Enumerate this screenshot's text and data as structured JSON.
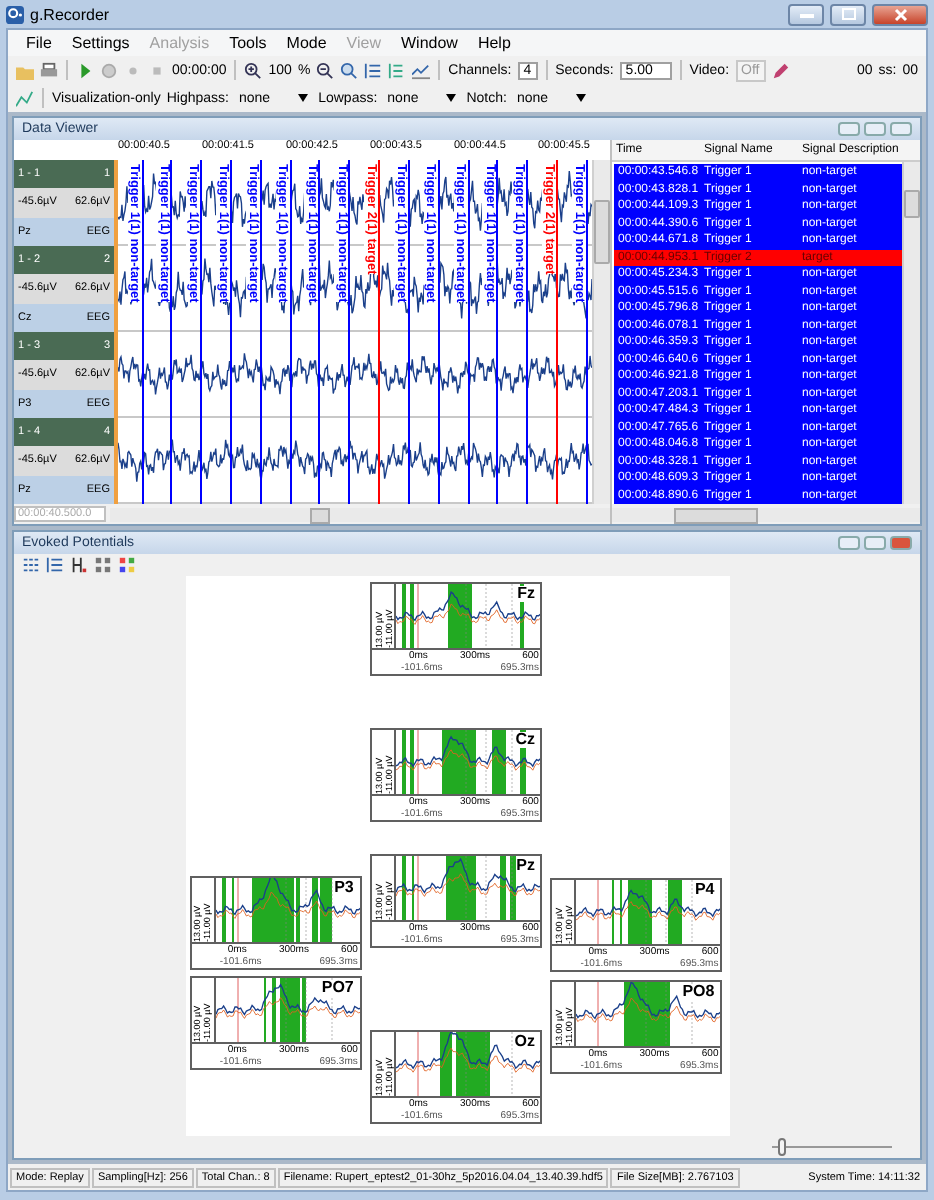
{
  "window": {
    "title": "g.Recorder"
  },
  "menu": [
    {
      "label": "File",
      "disabled": false
    },
    {
      "label": "Settings",
      "disabled": false
    },
    {
      "label": "Analysis",
      "disabled": true
    },
    {
      "label": "Tools",
      "disabled": false
    },
    {
      "label": "Mode",
      "disabled": false
    },
    {
      "label": "View",
      "disabled": true
    },
    {
      "label": "Window",
      "disabled": false
    },
    {
      "label": "Help",
      "disabled": false
    }
  ],
  "toolbar": {
    "time": "00:00:00",
    "zoom": "100",
    "zoom_unit": "%",
    "channels_label": "Channels:",
    "channels": "4",
    "seconds_label": "Seconds:",
    "seconds": "5.00",
    "video_label": "Video:",
    "video": "Off",
    "video_disabled": true,
    "clock": [
      "00",
      "ss:",
      "00"
    ]
  },
  "filter_bar": {
    "mode": "Visualization-only",
    "filters": [
      {
        "label": "Highpass:",
        "value": "none"
      },
      {
        "label": "Lowpass:",
        "value": "none"
      },
      {
        "label": "Notch:",
        "value": "none"
      }
    ]
  },
  "data_viewer": {
    "title": "Data Viewer",
    "time_labels": [
      "00:00:40.5",
      "00:00:41.5",
      "00:00:42.5",
      "00:00:43.5",
      "00:00:44.5",
      "00:00:45.5"
    ],
    "channels": [
      {
        "name": "1 - 1",
        "number": "1",
        "min": "-45.6µV",
        "max": "62.6µV",
        "electrode": "Pz",
        "type": "EEG"
      },
      {
        "name": "1 - 2",
        "number": "2",
        "min": "-45.6µV",
        "max": "62.6µV",
        "electrode": "Cz",
        "type": "EEG"
      },
      {
        "name": "1 - 3",
        "number": "3",
        "min": "-45.6µV",
        "max": "62.6µV",
        "electrode": "P3",
        "type": "EEG"
      },
      {
        "name": "1 - 4",
        "number": "4",
        "min": "-45.6µV",
        "max": "62.6µV",
        "electrode": "Pz",
        "type": "EEG"
      }
    ],
    "markers": [
      {
        "label": "Trigger 1(1) non-target",
        "kind": "non-target"
      },
      {
        "label": "Trigger 1(1) non-target",
        "kind": "non-target"
      },
      {
        "label": "Trigger 1(1) non-target",
        "kind": "non-target"
      },
      {
        "label": "Trigger 1(1) non-target",
        "kind": "non-target"
      },
      {
        "label": "Trigger 1(1) non-target",
        "kind": "non-target"
      },
      {
        "label": "Trigger 1(1) non-target",
        "kind": "non-target"
      },
      {
        "label": "Trigger 1(1) non-target",
        "kind": "non-target"
      },
      {
        "label": "Trigger 1(1) non-target",
        "kind": "non-target"
      },
      {
        "label": "Trigger 2(1) target",
        "kind": "target"
      },
      {
        "label": "Trigger 1(1) non-target",
        "kind": "non-target"
      },
      {
        "label": "Trigger 1(1) non-target",
        "kind": "non-target"
      },
      {
        "label": "Trigger 1(1) non-target",
        "kind": "non-target"
      },
      {
        "label": "Trigger 1(1) non-target",
        "kind": "non-target"
      },
      {
        "label": "Trigger 1(1) non-target",
        "kind": "non-target"
      },
      {
        "label": "Trigger 2(1) target",
        "kind": "target"
      },
      {
        "label": "Trigger 1(1) non-target",
        "kind": "non-target"
      }
    ],
    "position": "00:00:40.500.0"
  },
  "events": {
    "columns": [
      "Time",
      "Signal Name",
      "Signal Description"
    ],
    "rows": [
      {
        "time": "00:00:43.546.8",
        "name": "Trigger 1",
        "description": "non-target",
        "color": "#0000ff"
      },
      {
        "time": "00:00:43.828.1",
        "name": "Trigger 1",
        "description": "non-target",
        "color": "#0000ff"
      },
      {
        "time": "00:00:44.109.3",
        "name": "Trigger 1",
        "description": "non-target",
        "color": "#0000ff"
      },
      {
        "time": "00:00:44.390.6",
        "name": "Trigger 1",
        "description": "non-target",
        "color": "#0000ff"
      },
      {
        "time": "00:00:44.671.8",
        "name": "Trigger 1",
        "description": "non-target",
        "color": "#0000ff"
      },
      {
        "time": "00:00:44.953.1",
        "name": "Trigger 2",
        "description": "target",
        "color": "#ff0000"
      },
      {
        "time": "00:00:45.234.3",
        "name": "Trigger 1",
        "description": "non-target",
        "color": "#0000ff"
      },
      {
        "time": "00:00:45.515.6",
        "name": "Trigger 1",
        "description": "non-target",
        "color": "#0000ff"
      },
      {
        "time": "00:00:45.796.8",
        "name": "Trigger 1",
        "description": "non-target",
        "color": "#0000ff"
      },
      {
        "time": "00:00:46.078.1",
        "name": "Trigger 1",
        "description": "non-target",
        "color": "#0000ff"
      },
      {
        "time": "00:00:46.359.3",
        "name": "Trigger 1",
        "description": "non-target",
        "color": "#0000ff"
      },
      {
        "time": "00:00:46.640.6",
        "name": "Trigger 1",
        "description": "non-target",
        "color": "#0000ff"
      },
      {
        "time": "00:00:46.921.8",
        "name": "Trigger 1",
        "description": "non-target",
        "color": "#0000ff"
      },
      {
        "time": "00:00:47.203.1",
        "name": "Trigger 1",
        "description": "non-target",
        "color": "#0000ff"
      },
      {
        "time": "00:00:47.484.3",
        "name": "Trigger 1",
        "description": "non-target",
        "color": "#0000ff"
      },
      {
        "time": "00:00:47.765.6",
        "name": "Trigger 1",
        "description": "non-target",
        "color": "#0000ff"
      },
      {
        "time": "00:00:48.046.8",
        "name": "Trigger 1",
        "description": "non-target",
        "color": "#0000ff"
      },
      {
        "time": "00:00:48.328.1",
        "name": "Trigger 1",
        "description": "non-target",
        "color": "#0000ff"
      },
      {
        "time": "00:00:48.609.3",
        "name": "Trigger 1",
        "description": "non-target",
        "color": "#0000ff"
      },
      {
        "time": "00:00:48.890.6",
        "name": "Trigger 1",
        "description": "non-target",
        "color": "#0000ff"
      }
    ]
  },
  "evoked": {
    "title": "Evoked Potentials",
    "plots": [
      {
        "electrode": "Fz",
        "y_max": "13.00 µV",
        "y_min": "-11.00 µV",
        "x_ticks": [
          "0ms",
          "300ms",
          "600"
        ],
        "x_start": "-101.6ms",
        "x_end": "695.3ms"
      },
      {
        "electrode": "Cz",
        "y_max": "13.00 µV",
        "y_min": "-11.00 µV",
        "x_ticks": [
          "0ms",
          "300ms",
          "600"
        ],
        "x_start": "-101.6ms",
        "x_end": "695.3ms"
      },
      {
        "electrode": "Pz",
        "y_max": "13.00 µV",
        "y_min": "-11.00 µV",
        "x_ticks": [
          "0ms",
          "300ms",
          "600"
        ],
        "x_start": "-101.6ms",
        "x_end": "695.3ms"
      },
      {
        "electrode": "P3",
        "y_max": "13.00 µV",
        "y_min": "-11.00 µV",
        "x_ticks": [
          "0ms",
          "300ms",
          "600"
        ],
        "x_start": "-101.6ms",
        "x_end": "695.3ms"
      },
      {
        "electrode": "P4",
        "y_max": "13.00 µV",
        "y_min": "-11.00 µV",
        "x_ticks": [
          "0ms",
          "300ms",
          "600"
        ],
        "x_start": "-101.6ms",
        "x_end": "695.3ms"
      },
      {
        "electrode": "PO7",
        "y_max": "13.00 µV",
        "y_min": "-11.00 µV",
        "x_ticks": [
          "0ms",
          "300ms",
          "600"
        ],
        "x_start": "-101.6ms",
        "x_end": "695.3ms"
      },
      {
        "electrode": "PO8",
        "y_max": "13.00 µV",
        "y_min": "-11.00 µV",
        "x_ticks": [
          "0ms",
          "300ms",
          "600"
        ],
        "x_start": "-101.6ms",
        "x_end": "695.3ms"
      },
      {
        "electrode": "Oz",
        "y_max": "13.00 µV",
        "y_min": "-11.00 µV",
        "x_ticks": [
          "0ms",
          "300ms",
          "600"
        ],
        "x_start": "-101.6ms",
        "x_end": "695.3ms"
      }
    ],
    "zoom_slider": {
      "level": 0.05
    }
  },
  "status_bar": [
    "Mode: Replay",
    "Sampling[Hz]: 256",
    "Total Chan.: 8",
    "Filename: Rupert_eptest2_01-30hz_5p2016.04.04_13.40.39.hdf5",
    "File Size[MB]: 2.767103",
    "System Time: 14:11:32"
  ]
}
